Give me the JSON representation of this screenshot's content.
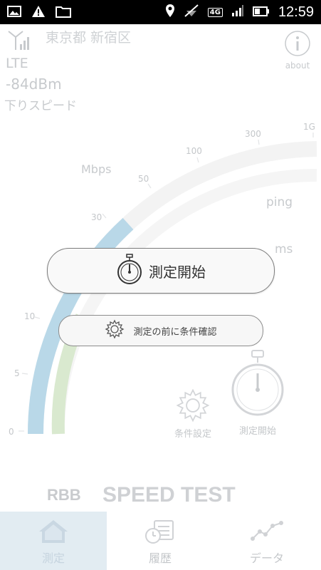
{
  "status_bar": {
    "time": "12:59",
    "network_badge": "4G"
  },
  "location": "東京都 新宿区",
  "network_type": "LTE",
  "signal_strength": "-84dBm",
  "download_label": "下りスピード",
  "about_label": "about",
  "gauge": {
    "unit_label": "Mbps",
    "ticks": [
      "0",
      "5",
      "10",
      "30",
      "50",
      "100",
      "300",
      "1G"
    ],
    "download_fill_fraction": 0.55,
    "upload_fill_fraction": 0.28
  },
  "ping_label": "ping",
  "ping_unit": "ms",
  "start_button_label": "測定開始",
  "conditions_button_label": "測定の前に条件確認",
  "mini_settings_label": "条件設定",
  "mini_start_label": "測定開始",
  "brand_logo": "RBB",
  "brand_title": "SPEED TEST",
  "nav": [
    {
      "label": "測定",
      "icon": "home-icon",
      "active": true
    },
    {
      "label": "履歴",
      "icon": "history-icon",
      "active": false
    },
    {
      "label": "データ",
      "icon": "chart-icon",
      "active": false
    }
  ],
  "colors": {
    "download_arc": "#b9d8e8",
    "upload_arc": "#d9e9cf",
    "track": "#f3f3f3",
    "active_nav": "#e2ecf2"
  }
}
